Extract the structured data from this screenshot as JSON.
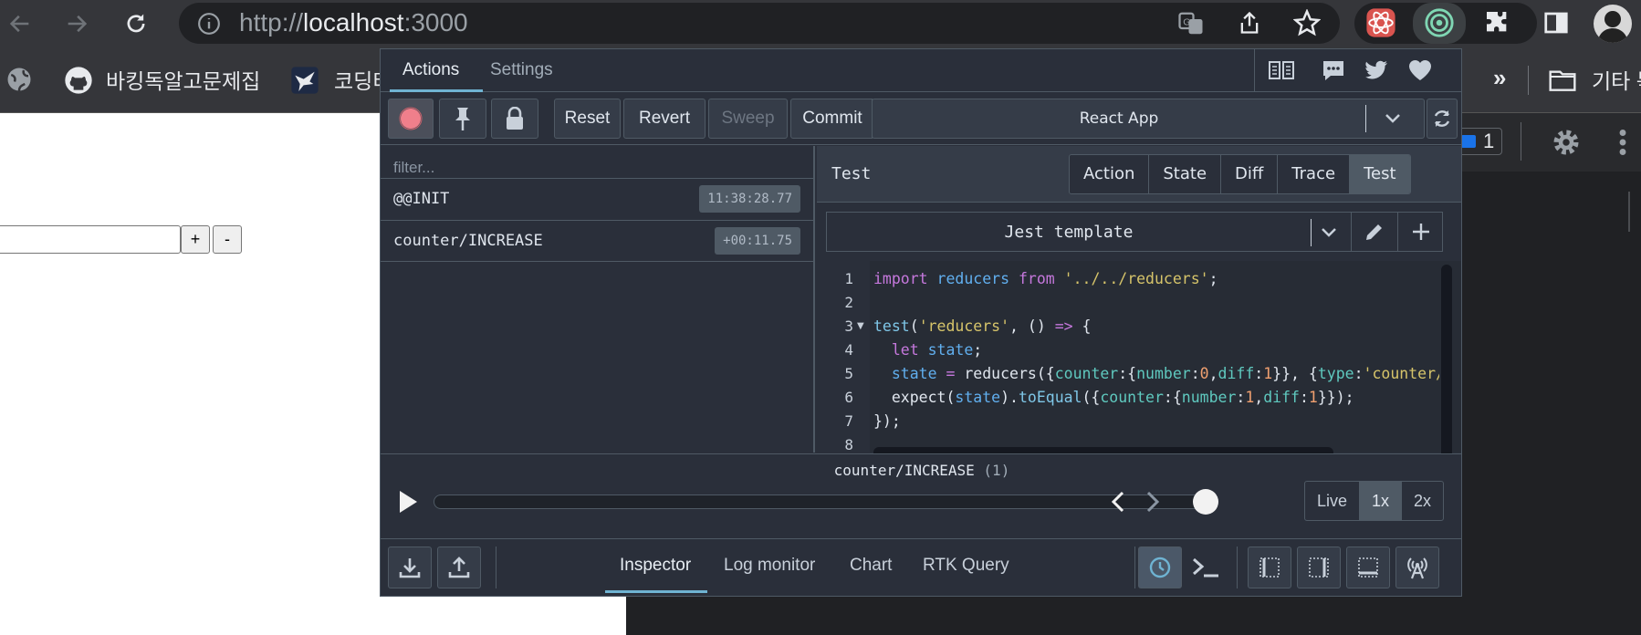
{
  "browser": {
    "url_scheme": "http://",
    "url_host": "localhost",
    "url_port": ":3000",
    "bookmarks": [
      {
        "label": "바킹독알고문제집",
        "icon": "github-icon"
      },
      {
        "label": "코딩터",
        "icon": "bird-icon"
      },
      {
        "label": "기타 북",
        "icon": "folder-icon"
      }
    ],
    "overflow": "»"
  },
  "page": {
    "increment_label": "+",
    "decrement_label": "-"
  },
  "devtools_behind": {
    "issues_count": "1"
  },
  "redux_devtools": {
    "tabs": [
      "Actions",
      "Settings"
    ],
    "active_tab": "Actions",
    "toolbar": {
      "reset": "Reset",
      "revert": "Revert",
      "sweep": "Sweep",
      "commit": "Commit",
      "instance": "React App"
    },
    "filter_placeholder": "filter...",
    "actions": [
      {
        "type": "@@INIT",
        "time": "11:38:28.77"
      },
      {
        "type": "counter/INCREASE",
        "time": "+00:11.75"
      }
    ],
    "inspector": {
      "title": "Test",
      "modes": [
        "Action",
        "State",
        "Diff",
        "Trace",
        "Test"
      ],
      "active_mode": "Test",
      "template_name": "Jest template"
    },
    "code_line_numbers": [
      "1",
      "2",
      "3",
      "4",
      "5",
      "6",
      "7",
      "8"
    ],
    "slider": {
      "action_label": "counter/INCREASE",
      "action_count": "(1)",
      "position_fraction": 1.0,
      "speeds": [
        "Live",
        "1x",
        "2x"
      ],
      "active_speed": "1x"
    },
    "monitors": [
      "Inspector",
      "Log monitor",
      "Chart",
      "RTK Query"
    ],
    "active_monitor": "Inspector"
  },
  "colors": {
    "panel_bg": "#2a2f3a",
    "border": "#4f5a65",
    "accent": "#6fb3d2",
    "record": "#f07f8b"
  }
}
